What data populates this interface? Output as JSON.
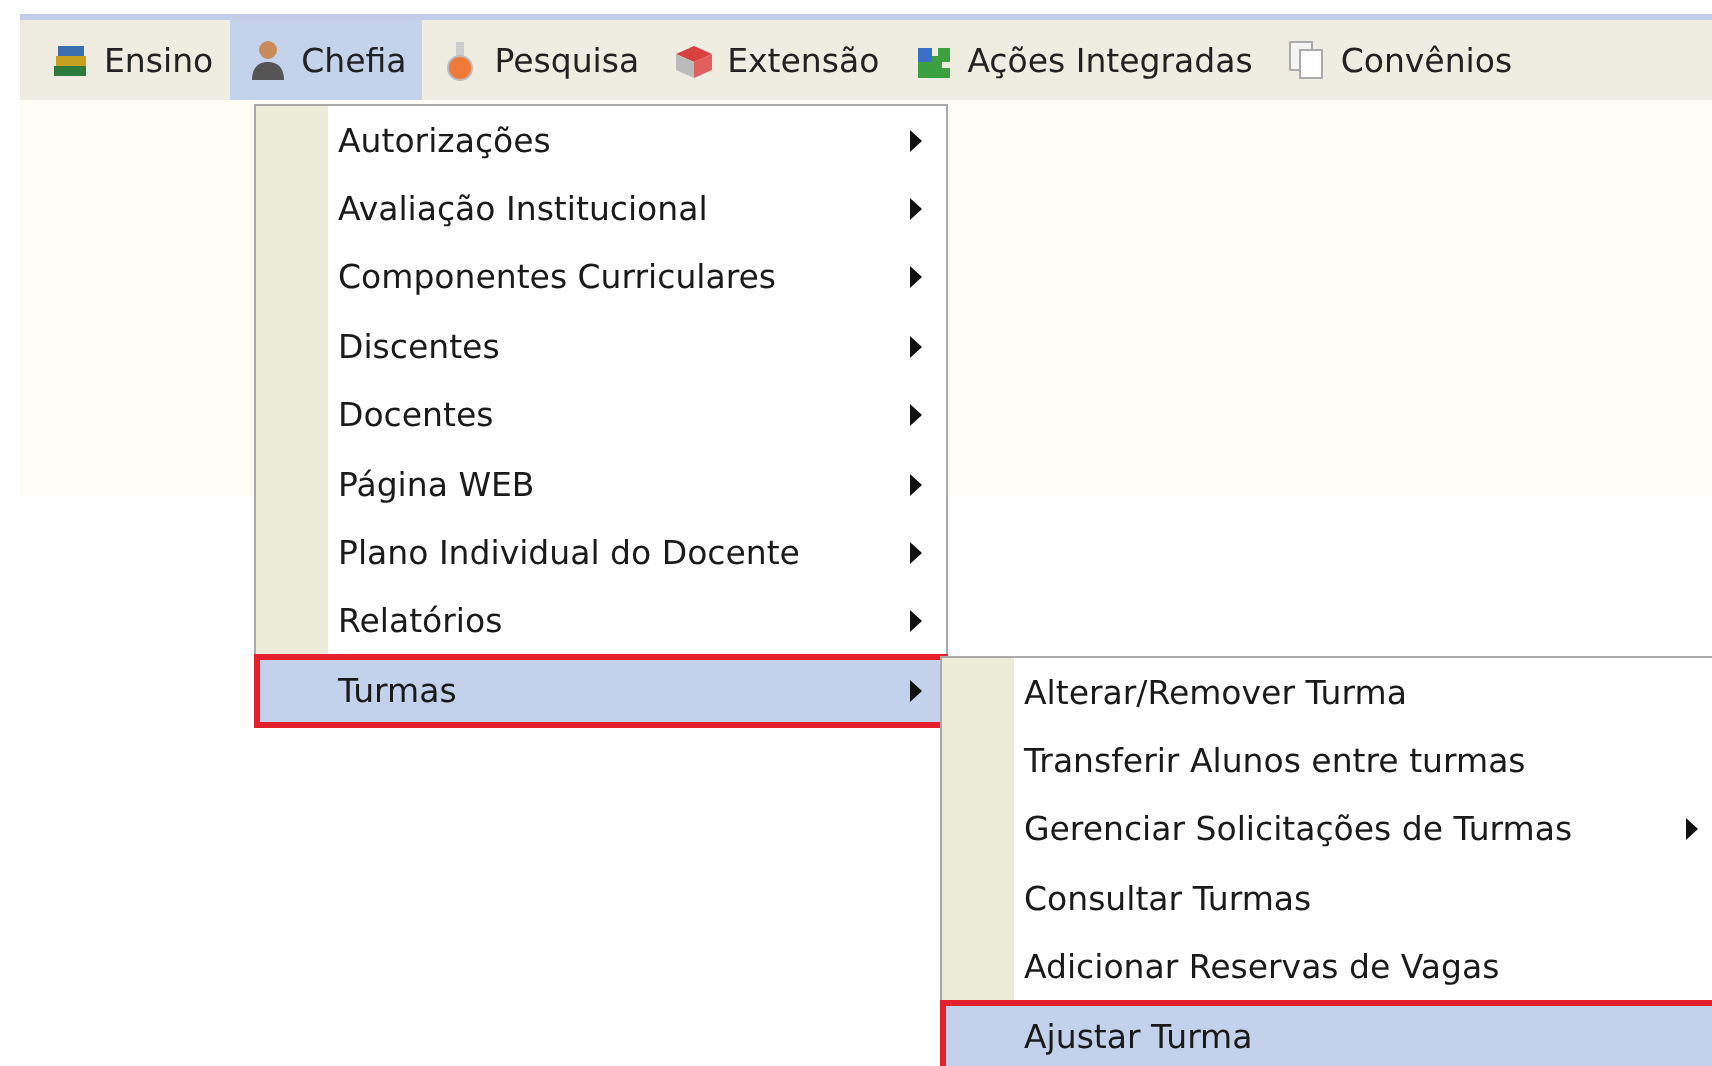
{
  "menubar": [
    {
      "label": "Ensino",
      "kind": "books",
      "selected": false
    },
    {
      "label": "Chefia",
      "kind": "person",
      "selected": true
    },
    {
      "label": "Pesquisa",
      "kind": "flask",
      "selected": false
    },
    {
      "label": "Extensão",
      "kind": "gift",
      "selected": false
    },
    {
      "label": "Ações Integradas",
      "kind": "puzzle",
      "selected": false
    },
    {
      "label": "Convênios",
      "kind": "pages",
      "selected": false
    }
  ],
  "menu": [
    {
      "label": "Autorizações",
      "has_submenu": true,
      "selected": false,
      "highlighted": false
    },
    {
      "label": "Avaliação Institucional",
      "has_submenu": true,
      "selected": false,
      "highlighted": false
    },
    {
      "label": "Componentes Curriculares",
      "has_submenu": true,
      "selected": false,
      "highlighted": false
    },
    {
      "label": "Discentes",
      "has_submenu": true,
      "selected": false,
      "highlighted": false
    },
    {
      "label": "Docentes",
      "has_submenu": true,
      "selected": false,
      "highlighted": false
    },
    {
      "label": "Página WEB",
      "has_submenu": true,
      "selected": false,
      "highlighted": false
    },
    {
      "label": "Plano Individual do Docente",
      "has_submenu": true,
      "selected": false,
      "highlighted": false
    },
    {
      "label": "Relatórios",
      "has_submenu": true,
      "selected": false,
      "highlighted": false
    },
    {
      "label": "Turmas",
      "has_submenu": true,
      "selected": true,
      "highlighted": true
    }
  ],
  "submenu": [
    {
      "label": "Alterar/Remover Turma",
      "has_submenu": false,
      "selected": false,
      "highlighted": false
    },
    {
      "label": "Transferir Alunos entre turmas",
      "has_submenu": false,
      "selected": false,
      "highlighted": false
    },
    {
      "label": "Gerenciar Solicitações de Turmas",
      "has_submenu": true,
      "selected": false,
      "highlighted": false
    },
    {
      "label": "Consultar Turmas",
      "has_submenu": false,
      "selected": false,
      "highlighted": false
    },
    {
      "label": "Adicionar Reservas de Vagas",
      "has_submenu": false,
      "selected": false,
      "highlighted": false
    },
    {
      "label": "Ajustar Turma",
      "has_submenu": false,
      "selected": true,
      "highlighted": true
    }
  ]
}
